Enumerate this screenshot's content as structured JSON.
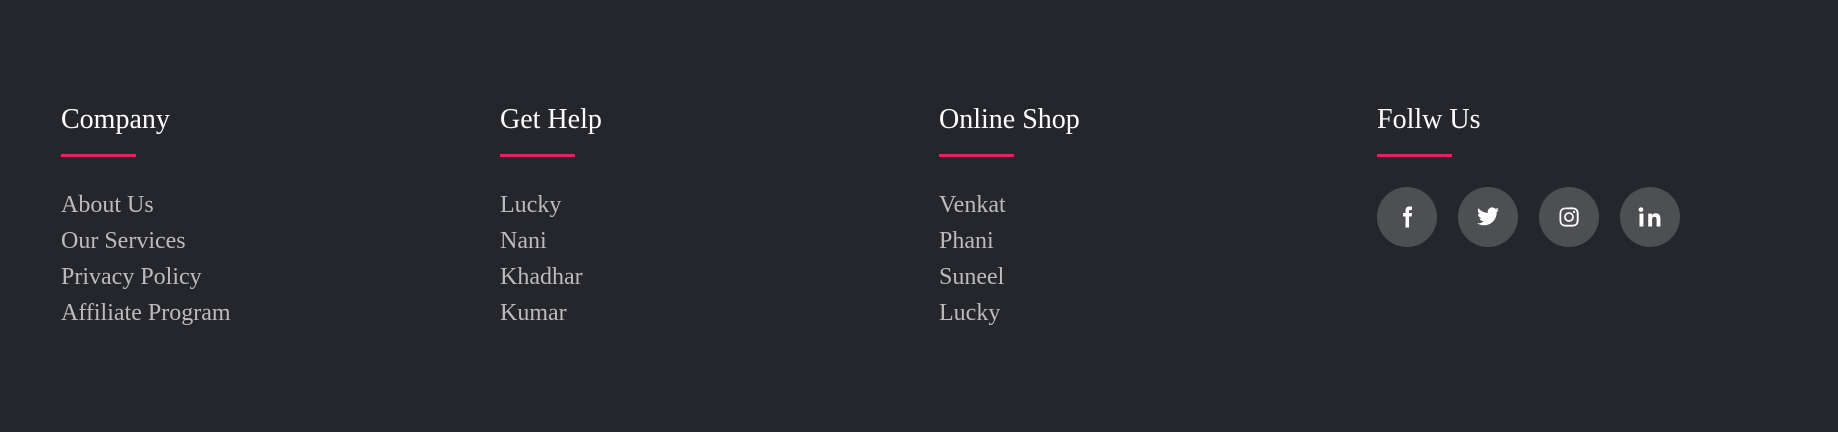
{
  "columns": [
    {
      "title": "Company",
      "links": [
        "About Us",
        "Our Services",
        "Privacy Policy",
        "Affiliate Program"
      ]
    },
    {
      "title": "Get Help",
      "links": [
        "Lucky",
        "Nani",
        "Khadhar",
        "Kumar"
      ]
    },
    {
      "title": "Online Shop",
      "links": [
        "Venkat",
        "Phani",
        "Suneel",
        "Lucky"
      ]
    }
  ],
  "follow": {
    "title": "Follw Us",
    "icons": [
      "facebook-icon",
      "twitter-icon",
      "instagram-icon",
      "linkedin-icon"
    ]
  },
  "colors": {
    "background": "#24262b",
    "accent": "#e91e63",
    "heading": "#ffffff",
    "link": "#bbbbbb",
    "icon_background": "#4d4f53"
  }
}
